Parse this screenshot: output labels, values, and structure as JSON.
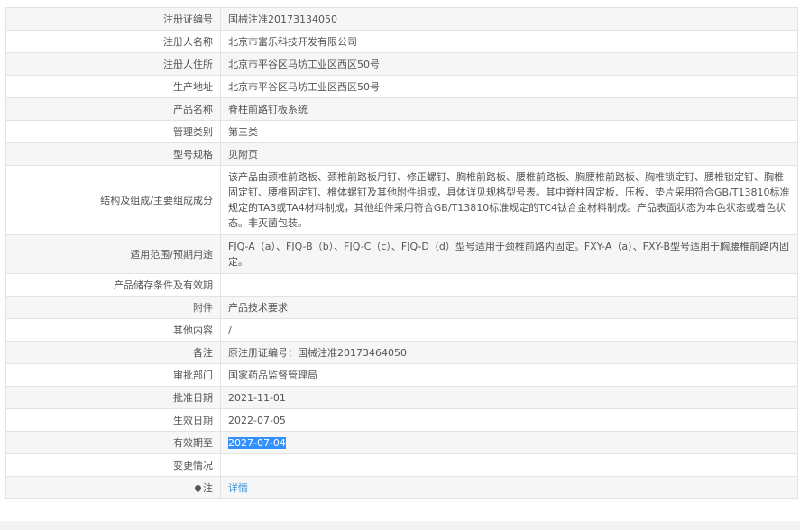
{
  "rows": [
    {
      "label": "注册证编号",
      "value": "国械注准20173134050"
    },
    {
      "label": "注册人名称",
      "value": "北京市富乐科技开发有限公司"
    },
    {
      "label": "注册人住所",
      "value": "北京市平谷区马坊工业区西区50号"
    },
    {
      "label": "生产地址",
      "value": "北京市平谷区马坊工业区西区50号"
    },
    {
      "label": "产品名称",
      "value": "脊柱前路钉板系统"
    },
    {
      "label": "管理类别",
      "value": "第三类"
    },
    {
      "label": "型号规格",
      "value": "见附页"
    },
    {
      "label": "结构及组成/主要组成成分",
      "value": "该产品由颈椎前路板、颈椎前路板用钉、修正螺钉、胸椎前路板、腰椎前路板、胸腰椎前路板、胸椎锁定钉、腰椎锁定钉、胸椎固定钉、腰椎固定钉、椎体螺钉及其他附件组成，具体详见规格型号表。其中脊柱固定板、压板、垫片采用符合GB/T13810标准规定的TA3或TA4材料制成，其他组件采用符合GB/T13810标准规定的TC4钛合金材料制成。产品表面状态为本色状态或着色状态。非灭菌包装。"
    },
    {
      "label": "适用范围/预期用途",
      "value": "FJQ-A（a）、FJQ-B（b）、FJQ-C（c）、FJQ-D（d）型号适用于颈椎前路内固定。FXY-A（a）、FXY-B型号适用于胸腰椎前路内固定。"
    },
    {
      "label": "产品储存条件及有效期",
      "value": ""
    },
    {
      "label": "附件",
      "value": "产品技术要求"
    },
    {
      "label": "其他内容",
      "value": "/"
    },
    {
      "label": "备注",
      "value": "原注册证编号：国械注准20173464050"
    },
    {
      "label": "审批部门",
      "value": "国家药品监督管理局"
    },
    {
      "label": "批准日期",
      "value": "2021-11-01"
    },
    {
      "label": "生效日期",
      "value": "2022-07-05"
    },
    {
      "label": "有效期至",
      "value": "2027-07-04"
    },
    {
      "label": "变更情况",
      "value": ""
    },
    {
      "label": "注",
      "value": "详情"
    }
  ],
  "icons": {
    "note": "pin-icon"
  },
  "colors": {
    "link": "#3a8fd6",
    "selection": "#3390ff"
  }
}
